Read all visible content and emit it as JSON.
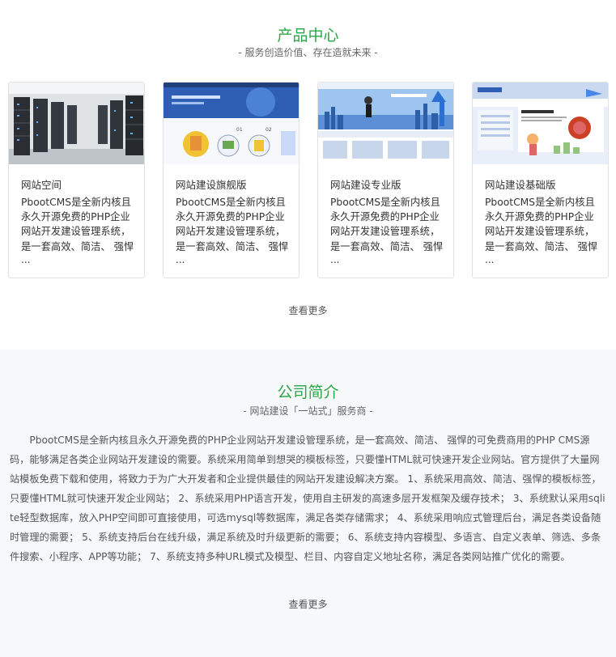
{
  "products": {
    "title": "产品中心",
    "subtitle": "- 服务创造价值、存在造就未来 -",
    "cards": [
      {
        "title": "网站空间",
        "desc": "PbootCMS是全新内核且永久开源免费的PHP企业网站开发建设管理系统，是一套高效、简洁、 强悍",
        "ellipsis": "...",
        "image": "server-room-photo"
      },
      {
        "title": "网站建设旗舰版",
        "desc": "PbootCMS是全新内核且永久开源免费的PHP企业网站开发建设管理系统，是一套高效、简洁、 强悍",
        "ellipsis": "...",
        "image": "website-template-preview"
      },
      {
        "title": "网站建设专业版",
        "desc": "PbootCMS是全新内核且永久开源免费的PHP企业网站开发建设管理系统，是一套高效、简洁、 强悍",
        "ellipsis": "...",
        "image": "website-template-preview"
      },
      {
        "title": "网站建设基础版",
        "desc": "PbootCMS是全新内核且永久开源免费的PHP企业网站开发建设管理系统，是一套高效、简洁、 强悍",
        "ellipsis": "...",
        "image": "website-template-preview"
      }
    ],
    "more_label": "查看更多"
  },
  "about": {
    "title": "公司简介",
    "subtitle": "- 网站建设「一站式」服务商 -",
    "body": "PbootCMS是全新内核且永久开源免费的PHP企业网站开发建设管理系统，是一套高效、简洁、 强悍的可免费商用的PHP CMS源码，能够满足各类企业网站开发建设的需要。系统采用简单到想哭的模板标签，只要懂HTML就可快速开发企业网站。官方提供了大量网站模板免费下载和使用，将致力于为广大开发者和企业提供最佳的网站开发建设解决方案。 1、系统采用高效、简洁、强悍的模板标签，只要懂HTML就可快速开发企业网站； 2、系统采用PHP语言开发，使用自主研发的高速多层开发框架及缓存技术； 3、系统默认采用sqlite轻型数据库，放入PHP空间即可直接使用，可选mysql等数据库，满足各类存储需求； 4、系统采用响应式管理后台，满足各类设备随时管理的需要； 5、系统支持后台在线升级，满足系统及时升级更新的需要； 6、系统支持内容模型、多语言、自定义表单、筛选、多条件搜索、小程序、APP等功能； 7、系统支持多种URL模式及模型、栏目、内容自定义地址名称，满足各类网站推广优化的需要。",
    "more_label": "查看更多"
  },
  "colors": {
    "accent": "#28a745",
    "about_bg": "#f7f8fa"
  }
}
